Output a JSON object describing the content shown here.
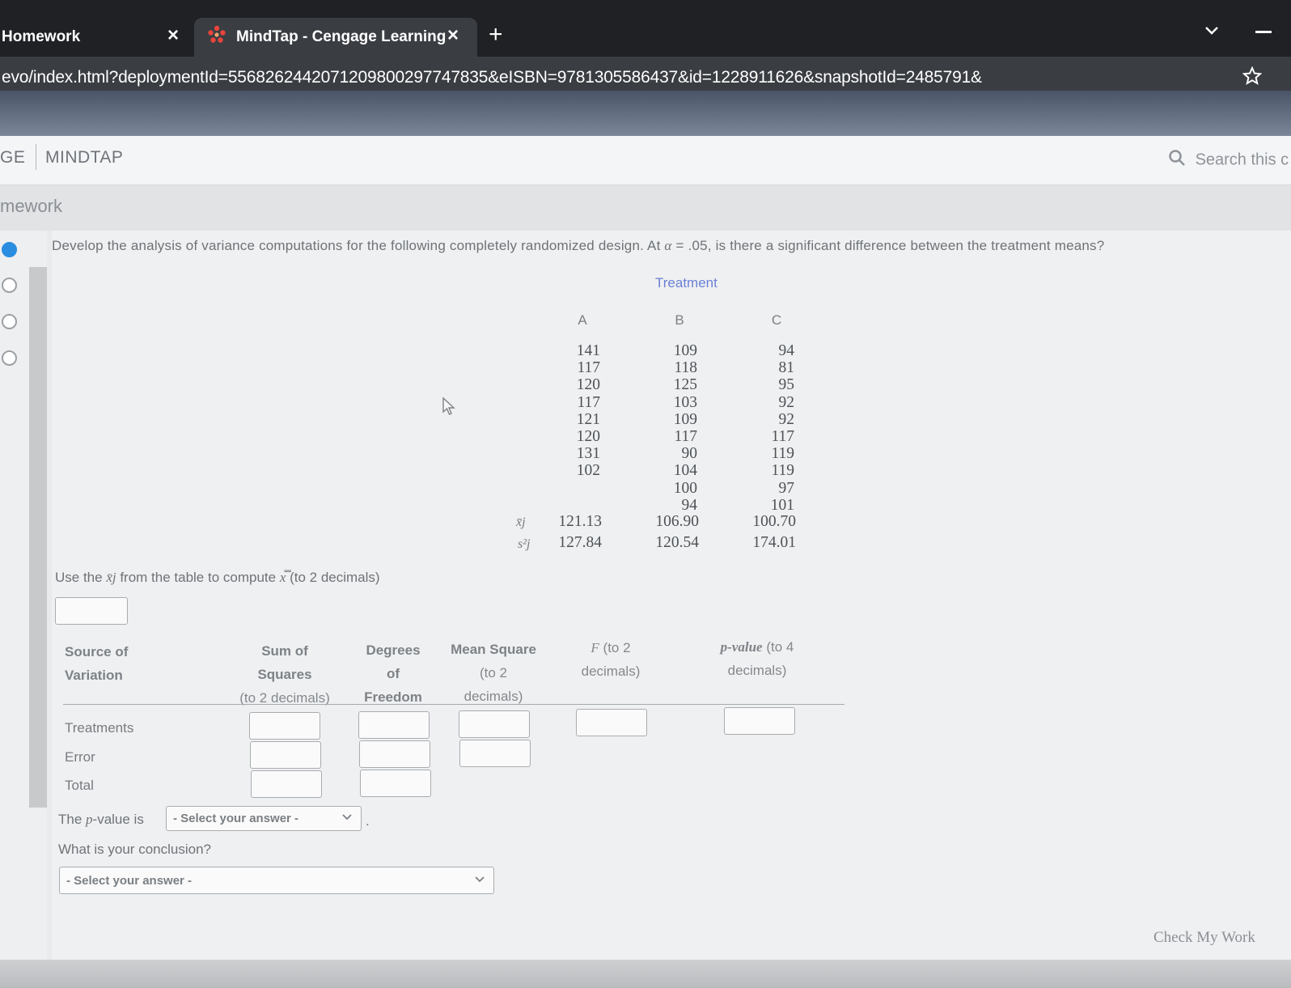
{
  "browser": {
    "tabs": [
      {
        "title": "Homework",
        "close": "×"
      },
      {
        "title": "MindTap - Cengage Learning",
        "close": "×"
      }
    ],
    "new_tab": "+",
    "url": "evo/index.html?deploymentId=5568262442071209800297747835&eISBN=9781305586437&id=1228911626&snapshotId=2485791&"
  },
  "app": {
    "brand_left": "GE",
    "brand": "MINDTAP",
    "search_placeholder": "Search this c",
    "page_title": "mework"
  },
  "question": {
    "text_before": "Develop the analysis of variance computations for the following completely randomized design. At ",
    "alpha": "α",
    "text_eq": " = .05",
    "text_after": ", is there a significant difference between the treatment means?"
  },
  "table": {
    "group_header": "Treatment",
    "columns": [
      "A",
      "B",
      "C"
    ],
    "data": {
      "A": [
        "141",
        "117",
        "120",
        "117",
        "121",
        "120",
        "131",
        "102"
      ],
      "B": [
        "109",
        "118",
        "125",
        "103",
        "109",
        "117",
        "90",
        "104",
        "100",
        "94"
      ],
      "C": [
        "94",
        "81",
        "95",
        "92",
        "92",
        "117",
        "119",
        "119",
        "97",
        "101"
      ]
    },
    "mean_label": "x̄j",
    "var_label": "s²j",
    "means": [
      "121.13",
      "106.90",
      "100.70"
    ],
    "variances": [
      "127.84",
      "120.54",
      "174.01"
    ]
  },
  "compute": {
    "text_a": "Use the ",
    "sym_a": "x̄j",
    "text_b": " from the table to compute ",
    "sym_b": "x̿",
    "text_c": " (to 2 decimals)"
  },
  "anova": {
    "headers": [
      [
        "Source of",
        "Variation"
      ],
      [
        "Sum of",
        "Squares",
        "(to 2 decimals)"
      ],
      [
        "Degrees",
        "of",
        "Freedom"
      ],
      [
        "Mean Square",
        "(to 2",
        "decimals)"
      ],
      [
        "F",
        " (to 2",
        "decimals)"
      ],
      [
        "p-value",
        " (to 4",
        "decimals)"
      ]
    ],
    "rows": [
      "Treatments",
      "Error",
      "Total"
    ]
  },
  "pvalue": {
    "text": "The ",
    "p": "p",
    "text2": "-value is",
    "select": "- Select your answer -"
  },
  "conclusion": {
    "label": "What is your conclusion?",
    "select": "- Select your answer -"
  },
  "check_button": "Check My Work",
  "colors": {
    "accent": "#2a8de0",
    "treatment": "#6a80d6"
  }
}
